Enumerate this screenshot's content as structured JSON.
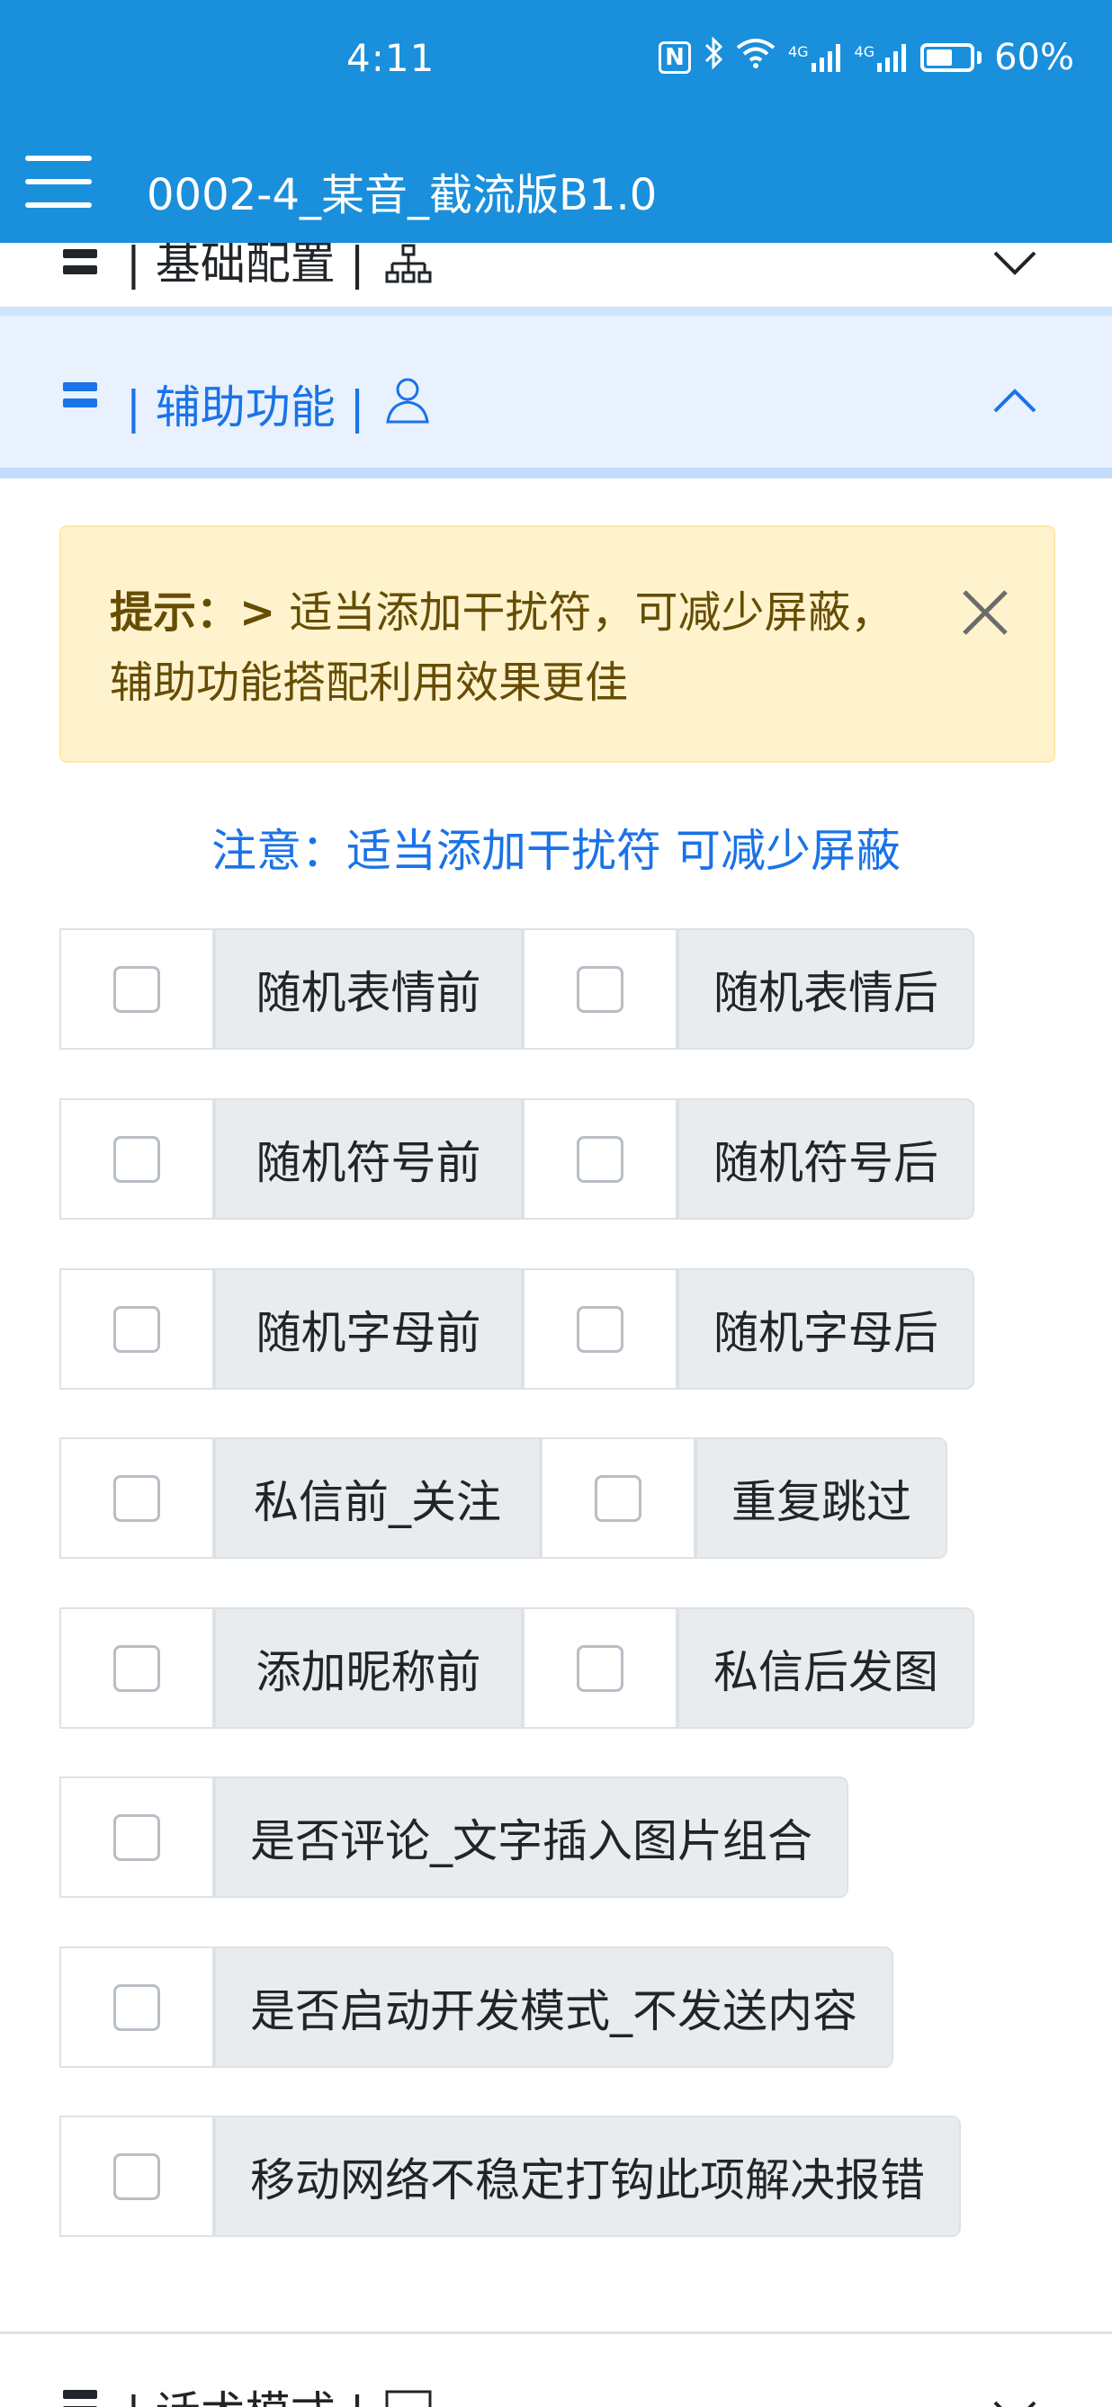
{
  "status_bar": {
    "time": "4:11",
    "nfc": "N",
    "network_1": "4G",
    "network_2": "4G",
    "battery_text": "60%",
    "battery_level": 0.6
  },
  "header": {
    "title": "0002-4_某音_截流版B1.0",
    "menu_icon": "hamburger-menu-icon"
  },
  "sections": {
    "basic": {
      "title": "| 基础配置 |",
      "icon": "org-chart-icon",
      "chevron": "chevron-down-icon"
    },
    "assist": {
      "title": "| 辅助功能 |",
      "icon": "user-icon",
      "chevron": "chevron-up-icon"
    },
    "talk": {
      "title": "| 话术模式 |",
      "icon": "image-icon",
      "chevron": "chevron-down-icon"
    }
  },
  "alert": {
    "strong": "提示：>",
    "text": " 适当添加干扰符，可减少屏蔽，辅助功能搭配利用效果更佳",
    "close_icon": "close-icon"
  },
  "notice": "注意：适当添加干扰符 可减少屏蔽",
  "options": [
    {
      "left": "随机表情前",
      "right": "随机表情后"
    },
    {
      "left": "随机符号前",
      "right": "随机符号后"
    },
    {
      "left": "随机字母前",
      "right": "随机字母后"
    },
    {
      "left": "私信前_关注",
      "right": "重复跳过"
    },
    {
      "left": "添加昵称前",
      "right": "私信后发图"
    },
    {
      "left": "是否评论_文字插入图片组合"
    },
    {
      "left": "是否启动开发模式_不发送内容"
    },
    {
      "left": "移动网络不稳定打钩此项解决报错"
    }
  ],
  "colors": {
    "primary": "#1a8fdb",
    "link": "#1a73e8",
    "alert_bg": "#fef3cd",
    "alert_text": "#664d03",
    "section_active_bg": "#e8f1fd"
  }
}
